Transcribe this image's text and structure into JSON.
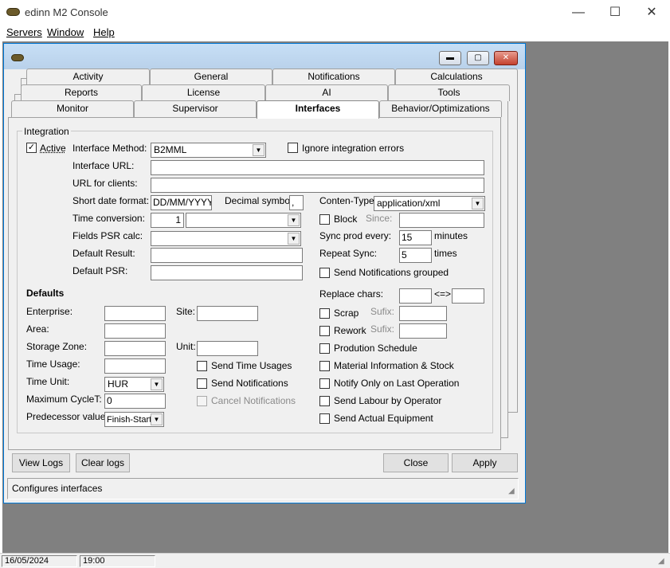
{
  "app": {
    "title": "edinn M2 Console",
    "minimize": "—",
    "maximize": "☐",
    "close": "✕"
  },
  "menu": {
    "servers": "Servers",
    "window": "Window",
    "help": "Help"
  },
  "status": {
    "date": "16/05/2024",
    "time": "19:00"
  },
  "tabs": {
    "row1": [
      "Activity",
      "General",
      "Notifications",
      "Calculations"
    ],
    "row2": [
      "Reports",
      "License",
      "AI",
      "Tools"
    ],
    "row3": [
      "Monitor",
      "Supervisor",
      "Interfaces",
      "Behavior/Optimizations"
    ]
  },
  "integration": {
    "group_title": "Integration",
    "active_label": "Active",
    "active_checked": true,
    "interface_method_label": "Interface Method:",
    "interface_method_value": "B2MML",
    "ignore_errors_label": "Ignore integration errors",
    "interface_url_label": "Interface URL:",
    "interface_url_value": "",
    "url_clients_label": "URL for clients:",
    "url_clients_value": "",
    "short_date_label": "Short date format:",
    "short_date_value": "DD/MM/YYYY",
    "decimal_label": "Decimal symbol:",
    "decimal_value": ",",
    "content_type_label": "Conten-Type:",
    "content_type_value": "application/xml",
    "time_conv_label": "Time conversion:",
    "time_conv_value": "1",
    "time_conv_unit": "",
    "block_label": "Block",
    "since_label": "Since:",
    "fields_psr_label": "Fields PSR calc:",
    "sync_prod_label": "Sync prod every:",
    "sync_prod_value": "15",
    "sync_prod_unit": "minutes",
    "default_result_label": "Default Result:",
    "repeat_sync_label": "Repeat Sync:",
    "repeat_sync_value": "5",
    "repeat_sync_unit": "times",
    "send_grouped_label": "Send Notifications grouped",
    "default_psr_label": "Default PSR:"
  },
  "defaults": {
    "title": "Defaults",
    "enterprise_label": "Enterprise:",
    "site_label": "Site:",
    "area_label": "Area:",
    "storage_label": "Storage Zone:",
    "unit_label": "Unit:",
    "time_usage_label": "Time Usage:",
    "time_unit_label": "Time Unit:",
    "time_unit_value": "HUR",
    "max_cycle_label": "Maximum CycleT:",
    "max_cycle_value": "0",
    "predecessor_label": "Predecessor value:",
    "predecessor_value": "Finish-Start",
    "send_time_usages": "Send Time Usages",
    "send_notifications": "Send Notifications",
    "cancel_notifications": "Cancel Notifications",
    "replace_chars_label": "Replace chars:",
    "replace_arrow": "<=>",
    "scrap_label": "Scrap",
    "rework_label": "Rework",
    "sufix_label": "Sufix:",
    "production_schedule": "Prodution Schedule",
    "material_info": "Material Information & Stock",
    "notify_last": "Notify Only on Last Operation",
    "send_labour": "Send Labour by Operator",
    "send_equipment": "Send Actual Equipment"
  },
  "buttons": {
    "view_logs": "View Logs",
    "clear_logs": "Clear logs",
    "close": "Close",
    "apply": "Apply"
  },
  "footer": {
    "status_text": "Configures interfaces"
  }
}
